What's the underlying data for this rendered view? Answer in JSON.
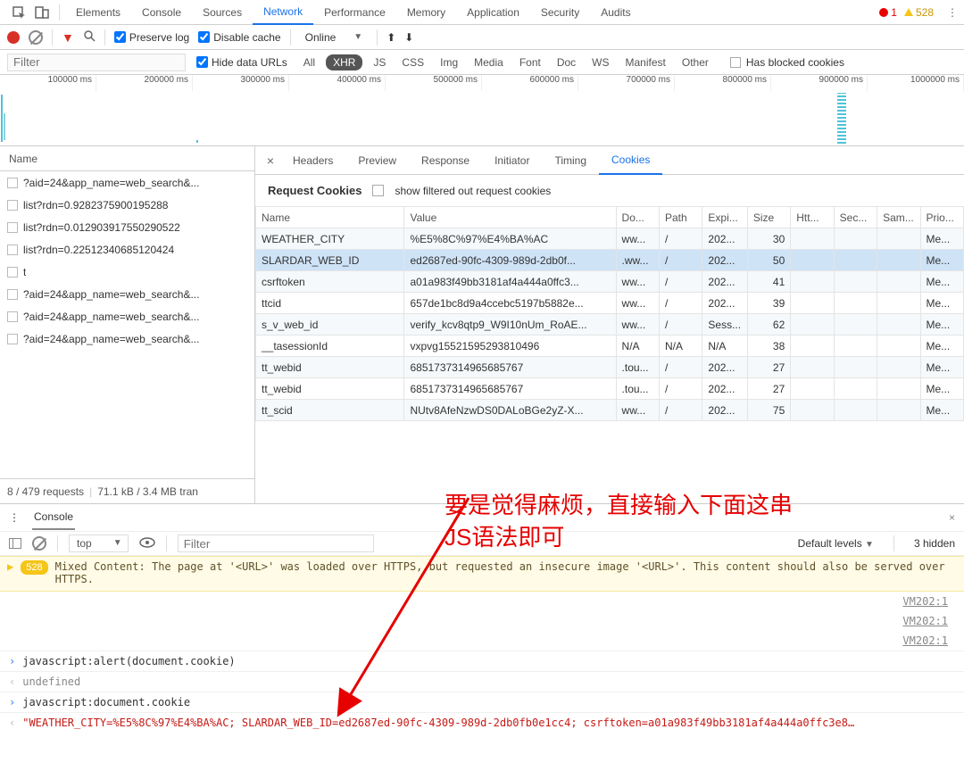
{
  "tabs": {
    "items": [
      "Elements",
      "Console",
      "Sources",
      "Network",
      "Performance",
      "Memory",
      "Application",
      "Security",
      "Audits"
    ],
    "active_index": 3,
    "errors": "1",
    "warnings": "528"
  },
  "toolbar": {
    "preserve_log": "Preserve log",
    "disable_cache": "Disable cache",
    "throttle": "Online"
  },
  "filterbar": {
    "filter_placeholder": "Filter",
    "hide_data_urls": "Hide data URLs",
    "types": [
      "All",
      "XHR",
      "JS",
      "CSS",
      "Img",
      "Media",
      "Font",
      "Doc",
      "WS",
      "Manifest",
      "Other"
    ],
    "active_type_index": 1,
    "blocked_cookies": "Has blocked cookies"
  },
  "timeline": {
    "ticks": [
      "100000 ms",
      "200000 ms",
      "300000 ms",
      "400000 ms",
      "500000 ms",
      "600000 ms",
      "700000 ms",
      "800000 ms",
      "900000 ms",
      "1000000 ms"
    ]
  },
  "requests": {
    "header": "Name",
    "items": [
      "?aid=24&app_name=web_search&...",
      "list?rdn=0.9282375900195288",
      "list?rdn=0.012903917550290522",
      "list?rdn=0.22512340685120424",
      "t",
      "?aid=24&app_name=web_search&...",
      "?aid=24&app_name=web_search&...",
      "?aid=24&app_name=web_search&..."
    ],
    "status": {
      "count": "8 / 479 requests",
      "transfer": "71.1 kB / 3.4 MB tran"
    }
  },
  "detail": {
    "tabs": [
      "Headers",
      "Preview",
      "Response",
      "Initiator",
      "Timing",
      "Cookies"
    ],
    "active_index": 5,
    "section_title": "Request Cookies",
    "show_filtered": "show filtered out request cookies",
    "columns": [
      "Name",
      "Value",
      "Do...",
      "Path",
      "Expi...",
      "Size",
      "Htt...",
      "Sec...",
      "Sam...",
      "Prio..."
    ],
    "rows": [
      {
        "name": "WEATHER_CITY",
        "value": "%E5%8C%97%E4%BA%AC",
        "domain": "ww...",
        "path": "/",
        "exp": "202...",
        "size": "30",
        "http": "",
        "sec": "",
        "sam": "",
        "prio": "Me..."
      },
      {
        "name": "SLARDAR_WEB_ID",
        "value": "ed2687ed-90fc-4309-989d-2db0f...",
        "domain": ".ww...",
        "path": "/",
        "exp": "202...",
        "size": "50",
        "http": "",
        "sec": "",
        "sam": "",
        "prio": "Me...",
        "sel": true
      },
      {
        "name": "csrftoken",
        "value": "a01a983f49bb3181af4a444a0ffc3...",
        "domain": "ww...",
        "path": "/",
        "exp": "202...",
        "size": "41",
        "http": "",
        "sec": "",
        "sam": "",
        "prio": "Me..."
      },
      {
        "name": "ttcid",
        "value": "657de1bc8d9a4ccebc5197b5882e...",
        "domain": "ww...",
        "path": "/",
        "exp": "202...",
        "size": "39",
        "http": "",
        "sec": "",
        "sam": "",
        "prio": "Me..."
      },
      {
        "name": "s_v_web_id",
        "value": "verify_kcv8qtp9_W9I10nUm_RoAE...",
        "domain": "ww...",
        "path": "/",
        "exp": "Sess...",
        "size": "62",
        "http": "",
        "sec": "",
        "sam": "",
        "prio": "Me..."
      },
      {
        "name": "__tasessionId",
        "value": "vxpvg15521595293810496",
        "domain": "N/A",
        "path": "N/A",
        "exp": "N/A",
        "size": "38",
        "http": "",
        "sec": "",
        "sam": "",
        "prio": "Me..."
      },
      {
        "name": "tt_webid",
        "value": "6851737314965685767",
        "domain": ".tou...",
        "path": "/",
        "exp": "202...",
        "size": "27",
        "http": "",
        "sec": "",
        "sam": "",
        "prio": "Me..."
      },
      {
        "name": "tt_webid",
        "value": "6851737314965685767",
        "domain": ".tou...",
        "path": "/",
        "exp": "202...",
        "size": "27",
        "http": "",
        "sec": "",
        "sam": "",
        "prio": "Me..."
      },
      {
        "name": "tt_scid",
        "value": "NUtv8AfeNzwDS0DALoBGe2yZ-X...",
        "domain": "ww...",
        "path": "/",
        "exp": "202...",
        "size": "75",
        "http": "",
        "sec": "",
        "sam": "",
        "prio": "Me..."
      }
    ]
  },
  "annotation": {
    "line1": "要是觉得麻烦，直接输入下面这串",
    "line2": "JS语法即可"
  },
  "console": {
    "drawer_title": "Console",
    "scope": "top",
    "filter_placeholder": "Filter",
    "levels": "Default levels",
    "hidden": "3 hidden",
    "warn_badge": "528",
    "warn_msg": "Mixed Content: The page at '<URL>' was loaded over HTTPS, but requested an insecure image '<URL>'. This content should also be served over HTTPS.",
    "vm_links": [
      "VM202:1",
      "VM202:1",
      "VM202:1"
    ],
    "lines": [
      {
        "caret": ">",
        "cls": "in",
        "text": "javascript:alert(document.cookie)"
      },
      {
        "caret": "<",
        "cls": "out und",
        "text": "undefined"
      },
      {
        "caret": ">",
        "cls": "in",
        "text": "javascript:document.cookie"
      },
      {
        "caret": "<",
        "cls": "out str",
        "text": "\"WEATHER_CITY=%E5%8C%97%E4%BA%AC; SLARDAR_WEB_ID=ed2687ed-90fc-4309-989d-2db0fb0e1cc4; csrftoken=a01a983f49bb3181af4a444a0ffc3e8…"
      }
    ]
  }
}
